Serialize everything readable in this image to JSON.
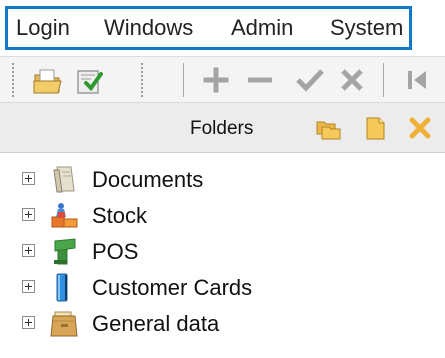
{
  "menubar": {
    "items": [
      {
        "label": "Login"
      },
      {
        "label": "Windows"
      },
      {
        "label": "Admin"
      },
      {
        "label": "System"
      }
    ],
    "highlight_color": "#1279c6"
  },
  "toolbar": {
    "buttons": [
      {
        "icon": "open-folder-icon"
      },
      {
        "icon": "checked-document-icon"
      },
      {
        "icon": "add-icon"
      },
      {
        "icon": "remove-icon"
      },
      {
        "icon": "confirm-icon"
      },
      {
        "icon": "cancel-icon"
      },
      {
        "icon": "first-record-icon"
      }
    ]
  },
  "folders_panel": {
    "title": "Folders",
    "buttons": [
      {
        "icon": "new-folder-icon"
      },
      {
        "icon": "rename-folder-icon"
      },
      {
        "icon": "delete-folder-icon"
      }
    ]
  },
  "tree": {
    "items": [
      {
        "label": "Documents",
        "icon": "documents-icon"
      },
      {
        "label": "Stock",
        "icon": "stock-icon"
      },
      {
        "label": "POS",
        "icon": "pos-icon"
      },
      {
        "label": "Customer Cards",
        "icon": "customer-cards-icon"
      },
      {
        "label": "General data",
        "icon": "general-data-icon"
      }
    ]
  }
}
